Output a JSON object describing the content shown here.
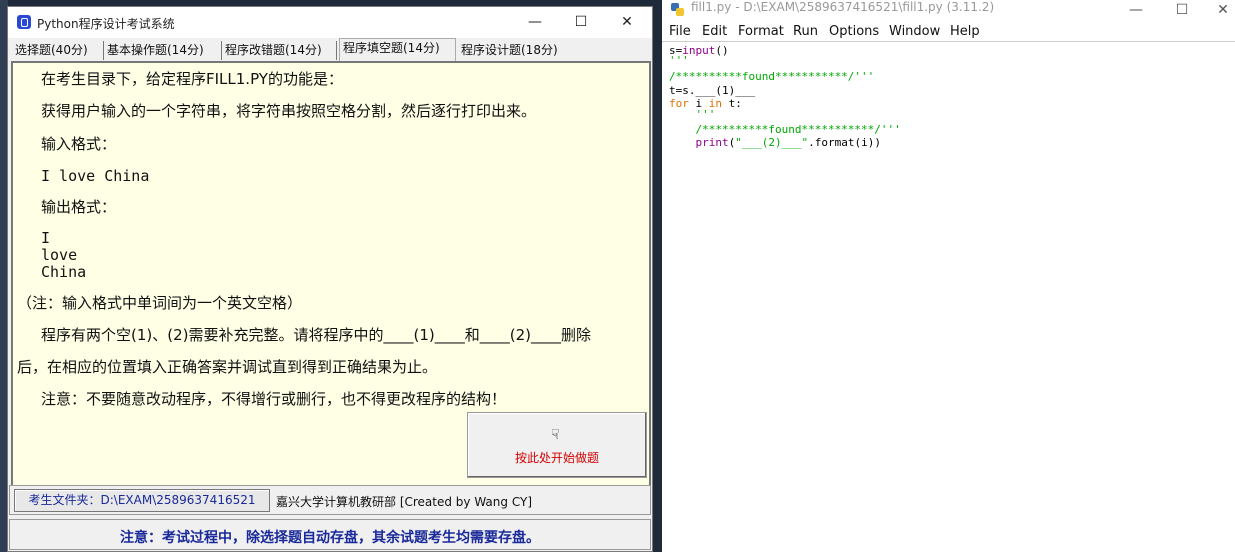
{
  "exam_window": {
    "title": "Python程序设计考试系统",
    "tabs": [
      "选择题(40分)",
      "基本操作题(14分)",
      "程序改错题(14分)",
      "程序填空题(14分)",
      "程序设计题(18分)"
    ],
    "active_tab": "程序填空题(14分)",
    "content": {
      "line1": "在考生目录下，给定程序FILL1.PY的功能是：",
      "line2": "获得用户输入的一个字符串，将字符串按照空格分割，然后逐行打印出来。",
      "input_label": "输入格式：",
      "input_example": "I love China",
      "output_label": "输出格式：",
      "output_lines": [
        "I",
        "love",
        "China"
      ],
      "note": "（注：输入格式中单词间为一个英文空格）",
      "instr1": "程序有两个空(1)、(2)需要补充完整。请将程序中的____(1)____和____(2)____删除",
      "instr2": "后，在相应的位置填入正确答案并调试直到得到正确结果为止。",
      "warning": "注意：不要随意改动程序，不得增行或删行，也不得更改程序的结构！"
    },
    "start_button": {
      "label": "按此处开始做题",
      "icon": "pointing-hand-icon"
    },
    "folder_button": "考生文件夹：D:\\EXAM\\2589637416521",
    "credit": "嘉兴大学计算机教研部 [Created by Wang CY]",
    "notice": "注意：考试过程中，除选择题自动存盘，其余试题考生均需要存盘。"
  },
  "idle_window": {
    "title": "fill1.py - D:\\EXAM\\2589637416521\\fill1.py (3.11.2)",
    "menu": [
      "File",
      "Edit",
      "Format",
      "Run",
      "Options",
      "Window",
      "Help"
    ],
    "code": {
      "l1a": "s=",
      "l1b": "input",
      "l1c": "()",
      "l2": "'''",
      "l3": "/**********found***********/'''",
      "l4": "t=s.___(1)___",
      "l5a": "for",
      "l5b": " i ",
      "l5c": "in",
      "l5d": " t:",
      "l6": "    '''",
      "l7": "    /**********found***********/'''",
      "l8a": "    ",
      "l8b": "print",
      "l8c": "(",
      "l8d": "\"___(2)___\"",
      "l8e": ".format(i))"
    }
  },
  "colors": {
    "content_bg": "#ffffe6",
    "start_label": "#d40000",
    "notice_text": "#1a2a9a",
    "keyword": "#e07000",
    "builtin": "#900090",
    "string": "#00aa00"
  }
}
